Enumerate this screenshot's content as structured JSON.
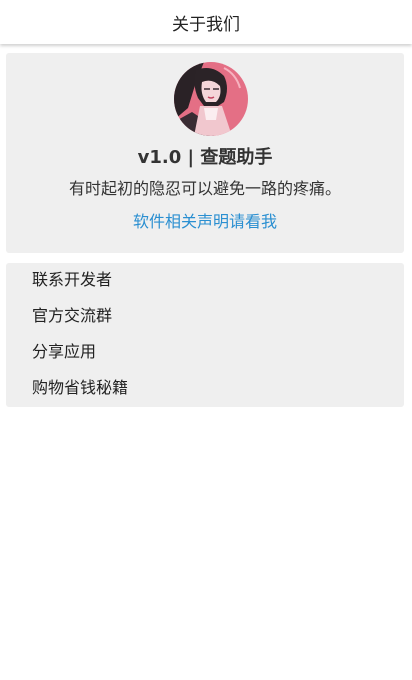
{
  "topbar": {
    "title": "关于我们"
  },
  "about": {
    "avatar_icon": "app-avatar-illustration",
    "version_line": "v1.0 | 查题助手",
    "motto": "有时起初的隐忍可以避免一路的疼痛。",
    "disclaimer_link": "软件相关声明请看我"
  },
  "menu": {
    "items": [
      {
        "label": "联系开发者"
      },
      {
        "label": "官方交流群"
      },
      {
        "label": "分享应用"
      },
      {
        "label": "购物省钱秘籍"
      }
    ]
  },
  "colors": {
    "link": "#2a8fd1",
    "card_background": "#efefef",
    "avatar_pink": "#e46f85"
  }
}
